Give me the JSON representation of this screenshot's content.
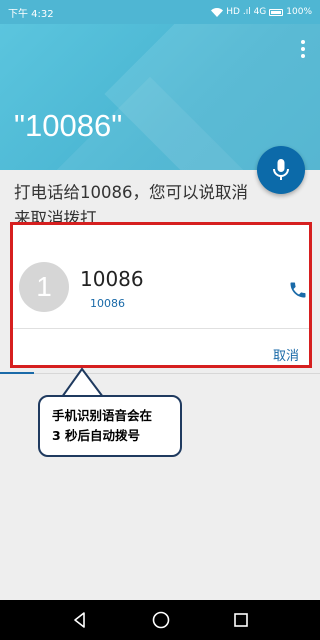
{
  "status_bar": {
    "time": "下午 4:32",
    "indicators": "HD .ıl 4G",
    "battery": "100%"
  },
  "header": {
    "query": "\"10086\""
  },
  "answer": {
    "text": "打电话给10086，您可以说取消来取消拨打"
  },
  "contact_card": {
    "avatar_letter": "1",
    "name": "10086",
    "number": "10086",
    "cancel_label": "取消"
  },
  "callout": {
    "line1": "手机识别语音会在",
    "line2": "3 秒后自动拨号"
  },
  "nav": {
    "icons": [
      "back-icon",
      "home-icon",
      "recents-icon"
    ]
  },
  "colors": {
    "header": "#4fb6d3",
    "mic_button": "#0c6aa9",
    "accent": "#1a6aa8",
    "highlight_border": "#d61f1f",
    "callout_border": "#1f3a5f"
  }
}
